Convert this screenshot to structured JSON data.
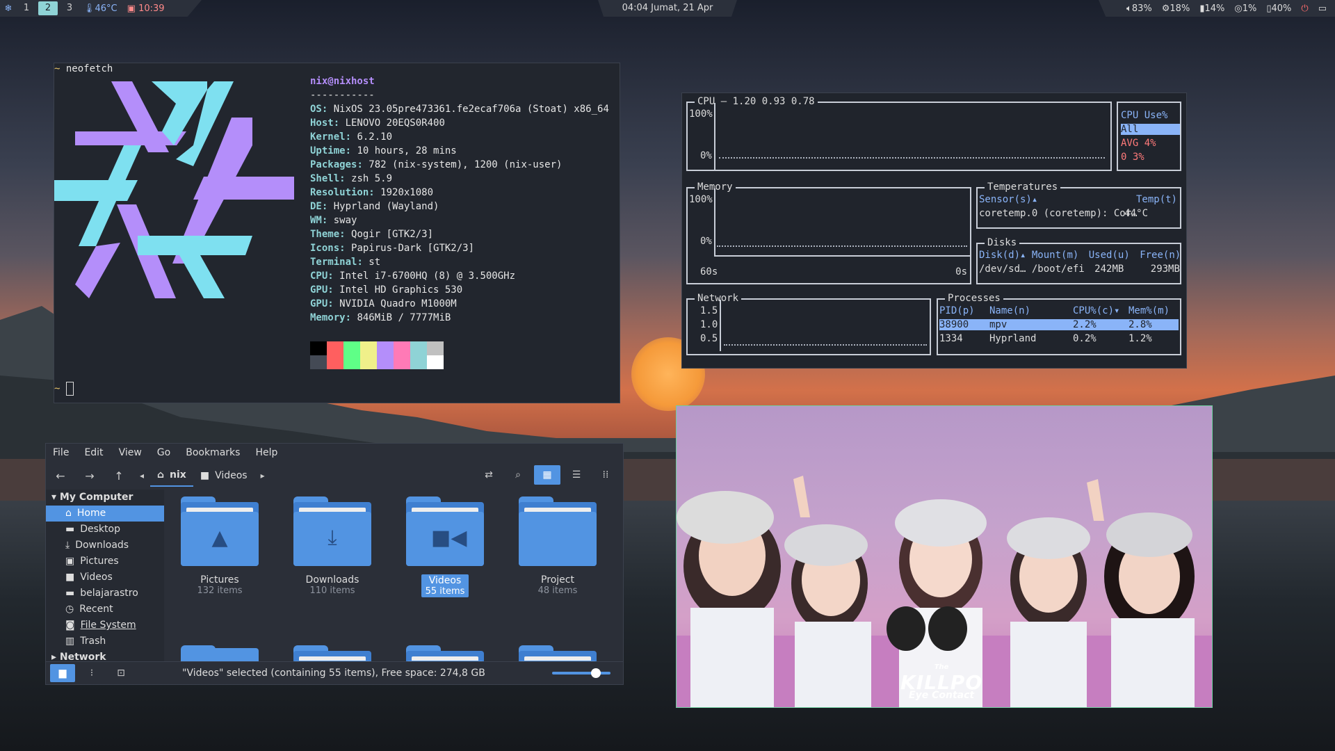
{
  "topbar": {
    "workspaces": [
      "1",
      "2",
      "3"
    ],
    "active_workspace": "2",
    "temperature": "46°C",
    "uptime_clock": "10:39",
    "datetime": "04:04  Jumat, 21 Apr",
    "volume": "83%",
    "cpu": "18%",
    "memory": "14%",
    "disk": "1%",
    "battery": "40%"
  },
  "neofetch": {
    "prompt_cmd": "neofetch",
    "user_host": "nix@nixhost",
    "separator": "-----------",
    "rows": [
      {
        "k": "OS",
        "v": "NixOS 23.05pre473361.fe2ecaf706a (Stoat) x86_64"
      },
      {
        "k": "Host",
        "v": "LENOVO 20EQS0R400"
      },
      {
        "k": "Kernel",
        "v": "6.2.10"
      },
      {
        "k": "Uptime",
        "v": "10 hours, 28 mins"
      },
      {
        "k": "Packages",
        "v": "782 (nix-system), 1200 (nix-user)"
      },
      {
        "k": "Shell",
        "v": "zsh 5.9"
      },
      {
        "k": "Resolution",
        "v": "1920x1080"
      },
      {
        "k": "DE",
        "v": "Hyprland (Wayland)"
      },
      {
        "k": "WM",
        "v": "sway"
      },
      {
        "k": "Theme",
        "v": "Qogir [GTK2/3]"
      },
      {
        "k": "Icons",
        "v": "Papirus-Dark [GTK2/3]"
      },
      {
        "k": "Terminal",
        "v": "st"
      },
      {
        "k": "CPU",
        "v": "Intel i7-6700HQ (8) @ 3.500GHz"
      },
      {
        "k": "GPU",
        "v": "Intel HD Graphics 530"
      },
      {
        "k": "GPU",
        "v": "NVIDIA Quadro M1000M"
      },
      {
        "k": "Memory",
        "v": "846MiB / 7777MiB"
      }
    ],
    "palette_top": [
      "#000000",
      "#ff5f5f",
      "#5fff87",
      "#f0f08a",
      "#b48efa",
      "#ff7ab6",
      "#8fd3d6",
      "#c0c0c0"
    ],
    "palette_bottom": [
      "#444a55",
      "#ff5f5f",
      "#5fff87",
      "#f0f08a",
      "#b48efa",
      "#ff7ab6",
      "#8fd3d6",
      "#ffffff"
    ],
    "logo_colors": {
      "purple": "#b48efa",
      "cyan": "#7ee0f0"
    }
  },
  "btop": {
    "cpu": {
      "title": "CPU",
      "load": "1.20 0.93 0.78",
      "y_top": "100%",
      "y_bottom": "0%",
      "hdr_cpu": "CPU",
      "hdr_use": "Use%",
      "all": "All",
      "avg_label": "AVG",
      "avg": "4%",
      "core": "0",
      "core_use": "3%"
    },
    "mem": {
      "title": "Memory",
      "y_top": "100%",
      "y_bottom": "0%",
      "x_left": "60s",
      "x_right": "0s"
    },
    "temps": {
      "title": "Temperatures",
      "col1": "Sensor(s)▴",
      "col2": "Temp(t)",
      "sensor": "coretemp.0 (coretemp): Cor…",
      "temp": "44°C"
    },
    "disks": {
      "title": "Disks",
      "cols": [
        "Disk(d)▴",
        "Mount(m)",
        "Used(u)",
        "Free(n)"
      ],
      "row": [
        "/dev/sd…",
        "/boot/efi",
        "242MB",
        "293MB"
      ]
    },
    "net": {
      "title": "Network",
      "ticks": [
        "1.5",
        "1.0",
        "0.5"
      ]
    },
    "procs": {
      "title": "Processes",
      "cols": [
        "PID(p)",
        "Name(n)",
        "CPU%(c)▾",
        "Mem%(m)"
      ],
      "rows": [
        [
          "38900",
          "mpv",
          "2.2%",
          "2.8%"
        ],
        [
          "1334",
          "Hyprland",
          "0.2%",
          "1.2%"
        ]
      ]
    }
  },
  "filemanager": {
    "menu": [
      "File",
      "Edit",
      "View",
      "Go",
      "Bookmarks",
      "Help"
    ],
    "crumbs": [
      "nix",
      "Videos"
    ],
    "sidebar_header": "My Computer",
    "sidebar_items": [
      {
        "label": "Home",
        "icon": "⌂"
      },
      {
        "label": "Desktop",
        "icon": "▬"
      },
      {
        "label": "Downloads",
        "icon": "⤓"
      },
      {
        "label": "Pictures",
        "icon": "▣"
      },
      {
        "label": "Videos",
        "icon": "■"
      },
      {
        "label": "belajarastro",
        "icon": "▬"
      },
      {
        "label": "Recent",
        "icon": "◷"
      },
      {
        "label": "File System",
        "icon": "◙"
      },
      {
        "label": "Trash",
        "icon": "▥"
      }
    ],
    "sidebar_network": "Network",
    "folders": [
      {
        "name": "Pictures",
        "count": "132 items"
      },
      {
        "name": "Downloads",
        "count": "110 items"
      },
      {
        "name": "Videos",
        "count": "55 items"
      },
      {
        "name": "Project",
        "count": "48 items"
      }
    ],
    "status": "\"Videos\" selected (containing 55 items), Free space: 274,8 GB",
    "zoom_level": 0.75
  },
  "image": {
    "logo_big": "KILLPO",
    "logo_the": "The",
    "logo_small": "Eye Contact"
  }
}
